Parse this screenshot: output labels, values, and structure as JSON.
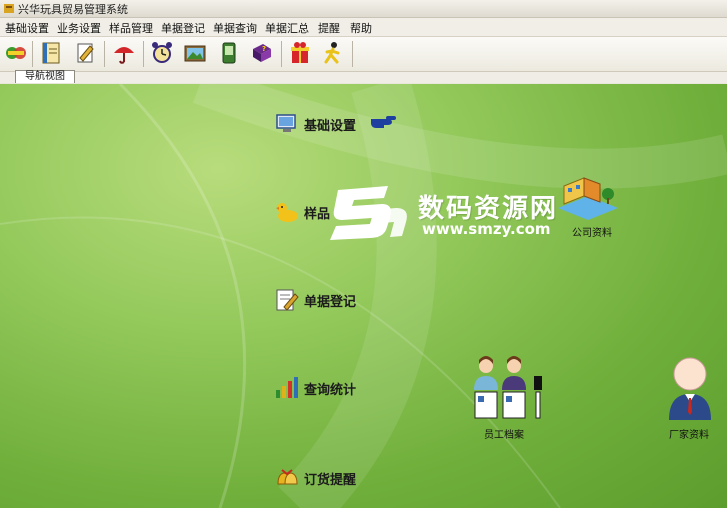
{
  "window": {
    "title": "兴华玩具贸易管理系统"
  },
  "menu": [
    "基础设置",
    "业务设置",
    "样品管理",
    "单据登记",
    "单据查询",
    "单据汇总",
    "提醒",
    "帮助"
  ],
  "toolbar": {
    "buttons": [
      "swap-icon",
      "notebook-icon",
      "document-edit-icon",
      "umbrella-icon",
      "alarm-clock-icon",
      "picture-icon",
      "handheld-icon",
      "help-book-icon",
      "gift-icon",
      "exit-runner-icon"
    ]
  },
  "tabs": {
    "nav_view": "导航视图"
  },
  "nav": {
    "basic_settings": "基础设置",
    "samples": "样品",
    "document_entry": "单据登记",
    "query_stats": "查询统计",
    "order_reminder": "订货提醒"
  },
  "modules": {
    "company_info": "公司资料",
    "employee_files": "员工档案",
    "manufacturer_info": "厂家资料"
  },
  "watermark": {
    "brand": "数码资源网",
    "url": "www.smzy.com"
  },
  "colors": {
    "background": "#7fbd47",
    "pointer": "#1f3fa0"
  }
}
